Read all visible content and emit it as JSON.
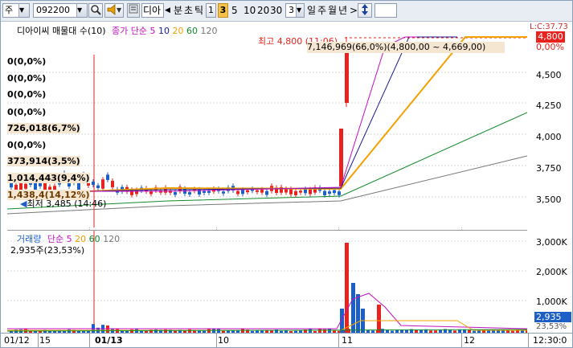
{
  "toolbar": {
    "market_type": "주",
    "stock_code": "092200",
    "stock_name": "디아",
    "period_selected": "3",
    "period_unit_minute": "분",
    "period_unit_tick": "초",
    "period_unit_tick2": "틱",
    "interval_buttons": [
      "1",
      "3",
      "5",
      "10",
      "20",
      "30"
    ],
    "interval_select": "3",
    "range_buttons": [
      "일",
      "주",
      "월",
      "년"
    ],
    "nav_right": ">",
    "nav_left": "◀"
  },
  "price_panel": {
    "legend": {
      "title": "디아이씨 매물대 수(10)",
      "ma_label": "종가 단순",
      "ma_periods": [
        "5",
        "10",
        "20",
        "60",
        "120"
      ]
    },
    "volume_profile_labels": [
      "0(0,0%)",
      "0(0,0%)",
      "0(0,0%)",
      "0(0,0%)",
      "726,018(6,7%)",
      "0(0,0%)",
      "373,914(3,5%)",
      "1,014,443(9,4%)",
      "1,438,4(14,12%)"
    ],
    "high_annotation": "최고 4,800 (11:06)",
    "range_annotation": "7,146,969(66,0%)(4,800,00 ~ 4,669,00)",
    "low_annotation": "최저 3,485 (14:46)",
    "y_ticks": [
      "4,500",
      "4,250",
      "4,000",
      "3,750",
      "3,500"
    ],
    "current_price": "4,800",
    "current_change": "0,00%",
    "top_clip": "L:C:37.73"
  },
  "volume_panel": {
    "legend": {
      "title": "거래량",
      "ma_label": "단순",
      "ma_periods": [
        "5",
        "20",
        "60",
        "120"
      ]
    },
    "current_volume": "2,935주(23,53%)",
    "y_ticks": [
      "3,000K",
      "2,000K",
      "1,000K"
    ],
    "current_value": "2,935",
    "current_pct": "23,53%"
  },
  "x_axis": {
    "labels": [
      "01/12",
      "15",
      "01/13",
      "10",
      "11",
      "12",
      "12:30:0"
    ]
  },
  "colors": {
    "up": "#e8231f",
    "down": "#1c5fc6",
    "ma5": "#c012c0",
    "ma10": "#1a1a8c",
    "ma20": "#f2a100",
    "ma60": "#118a2c",
    "ma120": "#777777"
  }
}
